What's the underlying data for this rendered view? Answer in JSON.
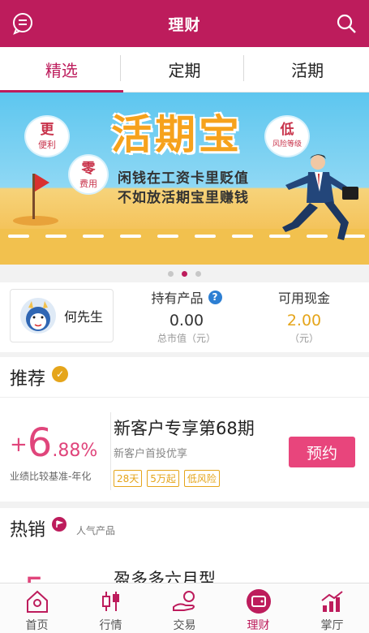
{
  "header": {
    "title": "理财"
  },
  "tabs": [
    {
      "label": "精选",
      "active": true
    },
    {
      "label": "定期",
      "active": false
    },
    {
      "label": "活期",
      "active": false
    }
  ],
  "banner": {
    "title": "活期宝",
    "slogan_line1": "闲钱在工资卡里贬值",
    "slogan_line2": "不如放活期宝里赚钱",
    "clouds": [
      {
        "big": "更",
        "small": "便利"
      },
      {
        "big": "零",
        "small": "费用"
      },
      {
        "big": "低",
        "small": "风险等级"
      }
    ],
    "flag_char": "活",
    "active_slide": 2,
    "slide_count": 3
  },
  "account": {
    "user_name": "何先生",
    "holding_label": "持有产品",
    "holding_value": "0.00",
    "holding_sub": "总市值（元）",
    "cash_label": "可用现金",
    "cash_value": "2.00",
    "cash_sub": "（元）"
  },
  "recommend": {
    "title": "推荐",
    "rate_plus": "+",
    "rate_int": "6",
    "rate_dec": ".88%",
    "rate_label": "业绩比较基准-年化",
    "product_name": "新客户专享第68期",
    "product_sub": "新客户首投优享",
    "tags": [
      "28天",
      "5万起",
      "低风险"
    ],
    "button_label": "预约"
  },
  "hot": {
    "title": "热销",
    "subtitle": "人气产品",
    "rate_partial": "5",
    "product_name": "盈多多六月型"
  },
  "nav": [
    {
      "label": "首页",
      "icon": "home-icon"
    },
    {
      "label": "行情",
      "icon": "market-icon"
    },
    {
      "label": "交易",
      "icon": "trade-icon"
    },
    {
      "label": "理财",
      "icon": "wallet-icon",
      "active": true
    },
    {
      "label": "掌厅",
      "icon": "chart-icon"
    }
  ],
  "colors": {
    "brand": "#bd1c5c",
    "accent": "#e8457c",
    "gold": "#e5a51b"
  }
}
